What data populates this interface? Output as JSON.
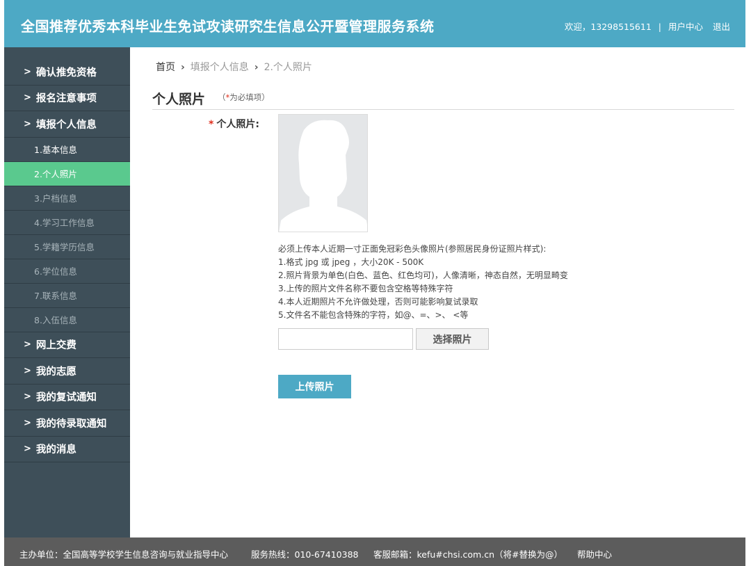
{
  "header": {
    "title": "全国推荐优秀本科毕业生免试攻读研究生信息公开暨管理服务系统",
    "welcome": "欢迎，13298515611",
    "separator": "|",
    "user_center": "用户中心",
    "logout": "退出"
  },
  "sidebar": {
    "items": [
      {
        "label": "确认推免资格"
      },
      {
        "label": "报名注意事项"
      },
      {
        "label": "填报个人信息"
      }
    ],
    "sub_items": [
      {
        "label": "1.基本信息",
        "state": "done"
      },
      {
        "label": "2.个人照片",
        "state": "active"
      },
      {
        "label": "3.户档信息",
        "state": "pending"
      },
      {
        "label": "4.学习工作信息",
        "state": "pending"
      },
      {
        "label": "5.学籍学历信息",
        "state": "pending"
      },
      {
        "label": "6.学位信息",
        "state": "pending"
      },
      {
        "label": "7.联系信息",
        "state": "pending"
      },
      {
        "label": "8.入伍信息",
        "state": "pending"
      }
    ],
    "items_after": [
      {
        "label": "网上交费"
      },
      {
        "label": "我的志愿"
      },
      {
        "label": "我的复试通知"
      },
      {
        "label": "我的待录取通知"
      },
      {
        "label": "我的消息"
      }
    ],
    "chevron": ">"
  },
  "breadcrumb": {
    "home": "首页",
    "level1": "填报个人信息",
    "level2": "2.个人照片",
    "separator": "›"
  },
  "section": {
    "title": "个人照片",
    "required_prefix": "（",
    "required_star": "*",
    "required_text": "为必填项）"
  },
  "form": {
    "star": "*",
    "photo_label": "个人照片:",
    "instructions": [
      "必须上传本人近期一寸正面免冠彩色头像照片(参照居民身份证照片样式):",
      "1.格式 jpg 或 jpeg ，大小20K - 500K",
      "2.照片背景为单色(白色、蓝色、红色均可)，人像清晰，神态自然，无明显畸变",
      "3.上传的照片文件名称不要包含空格等特殊字符",
      "4.本人近期照片不允许做处理，否则可能影响复试录取",
      "5.文件名不能包含特殊的字符，如@、=、>、 <等"
    ],
    "file_value": "",
    "choose_button": "选择照片",
    "upload_button": "上传照片"
  },
  "footer": {
    "host": "主办单位：全国高等学校学生信息咨询与就业指导中心",
    "hotline": "服务热线：010-67410388",
    "email": "客服邮箱：kefu#chsi.com.cn（将#替换为@）",
    "help": "帮助中心"
  },
  "colors": {
    "header_bg": "#4da9c5",
    "sidebar_bg": "#3e4f59",
    "active_item": "#5ac98e",
    "required_star": "#e0301e",
    "footer_bg": "#5c5c5c"
  }
}
